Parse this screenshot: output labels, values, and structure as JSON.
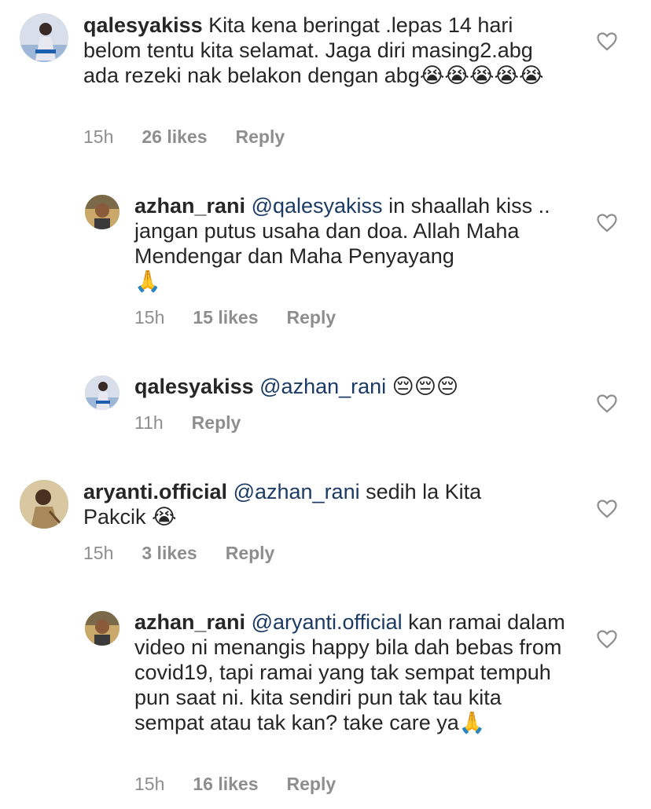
{
  "comments": [
    {
      "username": "qalesyakiss",
      "mention": "",
      "text": "Kita kena beringat .lepas 14 hari belom tentu kita selamat. Jaga diri masing2.abg ada rezeki nak belakon dengan abg",
      "emoji": "😭😭😭😭😭",
      "time": "15h",
      "likes": "26 likes",
      "reply_label": "Reply",
      "avatar_icon": "profile-photo-woman"
    },
    {
      "username": "azhan_rani",
      "mention": "@qalesyakiss",
      "text": "in shaallah kiss .. jangan putus usaha dan doa. Allah Maha Mendengar dan Maha Penyayang",
      "emoji": "🙏",
      "time": "15h",
      "likes": "15 likes",
      "reply_label": "Reply",
      "avatar_icon": "profile-photo-man"
    },
    {
      "username": "qalesyakiss",
      "mention": "@azhan_rani",
      "text": "",
      "emoji": "😔😔😔",
      "time": "11h",
      "likes": "",
      "reply_label": "Reply",
      "avatar_icon": "profile-photo-woman"
    },
    {
      "username": "aryanti.official",
      "mention": "@azhan_rani",
      "text": "sedih la Kita Pakcik",
      "emoji": "😭",
      "time": "15h",
      "likes": "3 likes",
      "reply_label": "Reply",
      "avatar_icon": "profile-photo-woman-portrait"
    },
    {
      "username": "azhan_rani",
      "mention": "@aryanti.official",
      "text": "kan ramai dalam video ni menangis happy bila dah bebas from covid19, tapi ramai yang tak sempat tempuh pun saat ni. kita sendiri pun tak tau kita sempat atau tak kan? take care ya",
      "emoji": "🙏",
      "time": "15h",
      "likes": "16 likes",
      "reply_label": "Reply",
      "avatar_icon": "profile-photo-man"
    }
  ],
  "colors": {
    "text": "#262626",
    "meta": "#8e8e8e",
    "mention": "#1b3a64",
    "heart": "#8e8e8e"
  },
  "icons": {
    "like": "heart-outline-icon"
  }
}
